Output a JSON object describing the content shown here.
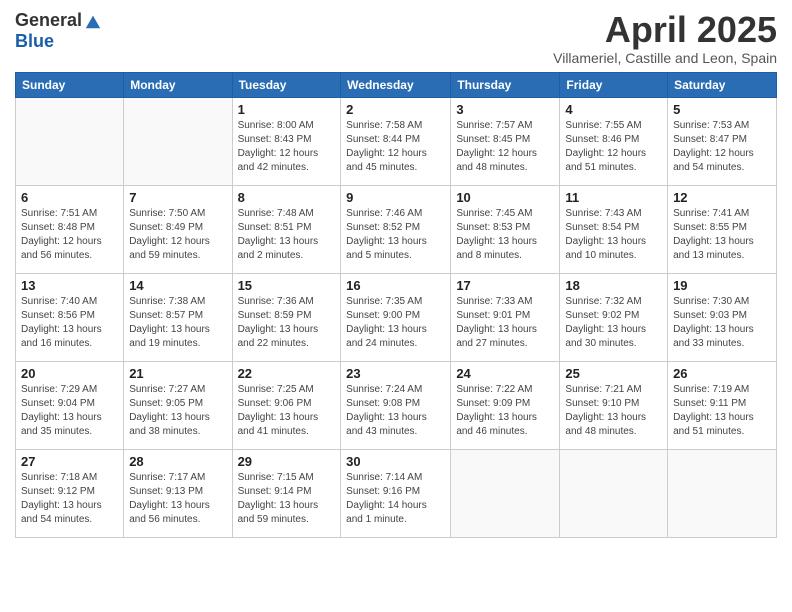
{
  "header": {
    "logo_general": "General",
    "logo_blue": "Blue",
    "month_title": "April 2025",
    "location": "Villameriel, Castille and Leon, Spain"
  },
  "days_of_week": [
    "Sunday",
    "Monday",
    "Tuesday",
    "Wednesday",
    "Thursday",
    "Friday",
    "Saturday"
  ],
  "weeks": [
    [
      {
        "day": "",
        "sunrise": "",
        "sunset": "",
        "daylight": ""
      },
      {
        "day": "",
        "sunrise": "",
        "sunset": "",
        "daylight": ""
      },
      {
        "day": "1",
        "sunrise": "Sunrise: 8:00 AM",
        "sunset": "Sunset: 8:43 PM",
        "daylight": "Daylight: 12 hours and 42 minutes."
      },
      {
        "day": "2",
        "sunrise": "Sunrise: 7:58 AM",
        "sunset": "Sunset: 8:44 PM",
        "daylight": "Daylight: 12 hours and 45 minutes."
      },
      {
        "day": "3",
        "sunrise": "Sunrise: 7:57 AM",
        "sunset": "Sunset: 8:45 PM",
        "daylight": "Daylight: 12 hours and 48 minutes."
      },
      {
        "day": "4",
        "sunrise": "Sunrise: 7:55 AM",
        "sunset": "Sunset: 8:46 PM",
        "daylight": "Daylight: 12 hours and 51 minutes."
      },
      {
        "day": "5",
        "sunrise": "Sunrise: 7:53 AM",
        "sunset": "Sunset: 8:47 PM",
        "daylight": "Daylight: 12 hours and 54 minutes."
      }
    ],
    [
      {
        "day": "6",
        "sunrise": "Sunrise: 7:51 AM",
        "sunset": "Sunset: 8:48 PM",
        "daylight": "Daylight: 12 hours and 56 minutes."
      },
      {
        "day": "7",
        "sunrise": "Sunrise: 7:50 AM",
        "sunset": "Sunset: 8:49 PM",
        "daylight": "Daylight: 12 hours and 59 minutes."
      },
      {
        "day": "8",
        "sunrise": "Sunrise: 7:48 AM",
        "sunset": "Sunset: 8:51 PM",
        "daylight": "Daylight: 13 hours and 2 minutes."
      },
      {
        "day": "9",
        "sunrise": "Sunrise: 7:46 AM",
        "sunset": "Sunset: 8:52 PM",
        "daylight": "Daylight: 13 hours and 5 minutes."
      },
      {
        "day": "10",
        "sunrise": "Sunrise: 7:45 AM",
        "sunset": "Sunset: 8:53 PM",
        "daylight": "Daylight: 13 hours and 8 minutes."
      },
      {
        "day": "11",
        "sunrise": "Sunrise: 7:43 AM",
        "sunset": "Sunset: 8:54 PM",
        "daylight": "Daylight: 13 hours and 10 minutes."
      },
      {
        "day": "12",
        "sunrise": "Sunrise: 7:41 AM",
        "sunset": "Sunset: 8:55 PM",
        "daylight": "Daylight: 13 hours and 13 minutes."
      }
    ],
    [
      {
        "day": "13",
        "sunrise": "Sunrise: 7:40 AM",
        "sunset": "Sunset: 8:56 PM",
        "daylight": "Daylight: 13 hours and 16 minutes."
      },
      {
        "day": "14",
        "sunrise": "Sunrise: 7:38 AM",
        "sunset": "Sunset: 8:57 PM",
        "daylight": "Daylight: 13 hours and 19 minutes."
      },
      {
        "day": "15",
        "sunrise": "Sunrise: 7:36 AM",
        "sunset": "Sunset: 8:59 PM",
        "daylight": "Daylight: 13 hours and 22 minutes."
      },
      {
        "day": "16",
        "sunrise": "Sunrise: 7:35 AM",
        "sunset": "Sunset: 9:00 PM",
        "daylight": "Daylight: 13 hours and 24 minutes."
      },
      {
        "day": "17",
        "sunrise": "Sunrise: 7:33 AM",
        "sunset": "Sunset: 9:01 PM",
        "daylight": "Daylight: 13 hours and 27 minutes."
      },
      {
        "day": "18",
        "sunrise": "Sunrise: 7:32 AM",
        "sunset": "Sunset: 9:02 PM",
        "daylight": "Daylight: 13 hours and 30 minutes."
      },
      {
        "day": "19",
        "sunrise": "Sunrise: 7:30 AM",
        "sunset": "Sunset: 9:03 PM",
        "daylight": "Daylight: 13 hours and 33 minutes."
      }
    ],
    [
      {
        "day": "20",
        "sunrise": "Sunrise: 7:29 AM",
        "sunset": "Sunset: 9:04 PM",
        "daylight": "Daylight: 13 hours and 35 minutes."
      },
      {
        "day": "21",
        "sunrise": "Sunrise: 7:27 AM",
        "sunset": "Sunset: 9:05 PM",
        "daylight": "Daylight: 13 hours and 38 minutes."
      },
      {
        "day": "22",
        "sunrise": "Sunrise: 7:25 AM",
        "sunset": "Sunset: 9:06 PM",
        "daylight": "Daylight: 13 hours and 41 minutes."
      },
      {
        "day": "23",
        "sunrise": "Sunrise: 7:24 AM",
        "sunset": "Sunset: 9:08 PM",
        "daylight": "Daylight: 13 hours and 43 minutes."
      },
      {
        "day": "24",
        "sunrise": "Sunrise: 7:22 AM",
        "sunset": "Sunset: 9:09 PM",
        "daylight": "Daylight: 13 hours and 46 minutes."
      },
      {
        "day": "25",
        "sunrise": "Sunrise: 7:21 AM",
        "sunset": "Sunset: 9:10 PM",
        "daylight": "Daylight: 13 hours and 48 minutes."
      },
      {
        "day": "26",
        "sunrise": "Sunrise: 7:19 AM",
        "sunset": "Sunset: 9:11 PM",
        "daylight": "Daylight: 13 hours and 51 minutes."
      }
    ],
    [
      {
        "day": "27",
        "sunrise": "Sunrise: 7:18 AM",
        "sunset": "Sunset: 9:12 PM",
        "daylight": "Daylight: 13 hours and 54 minutes."
      },
      {
        "day": "28",
        "sunrise": "Sunrise: 7:17 AM",
        "sunset": "Sunset: 9:13 PM",
        "daylight": "Daylight: 13 hours and 56 minutes."
      },
      {
        "day": "29",
        "sunrise": "Sunrise: 7:15 AM",
        "sunset": "Sunset: 9:14 PM",
        "daylight": "Daylight: 13 hours and 59 minutes."
      },
      {
        "day": "30",
        "sunrise": "Sunrise: 7:14 AM",
        "sunset": "Sunset: 9:16 PM",
        "daylight": "Daylight: 14 hours and 1 minute."
      },
      {
        "day": "",
        "sunrise": "",
        "sunset": "",
        "daylight": ""
      },
      {
        "day": "",
        "sunrise": "",
        "sunset": "",
        "daylight": ""
      },
      {
        "day": "",
        "sunrise": "",
        "sunset": "",
        "daylight": ""
      }
    ]
  ]
}
